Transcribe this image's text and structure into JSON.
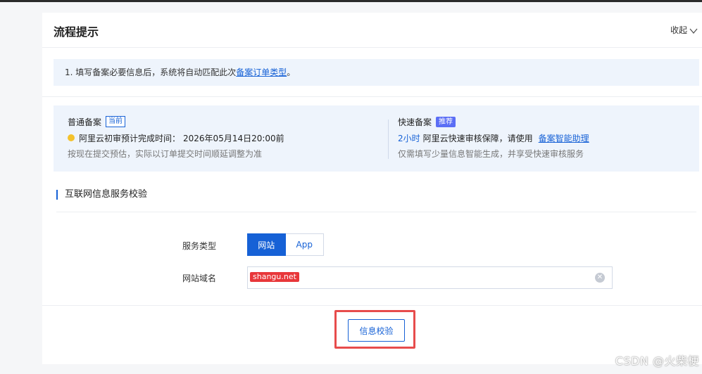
{
  "header": {
    "title": "流程提示",
    "collapse_label": "收起"
  },
  "tip": {
    "prefix": "1. 填写备案必要信息后，系统将自动匹配此次",
    "link": "备案订单类型",
    "suffix": "。"
  },
  "normal_filing": {
    "title": "普通备案",
    "tag": "当前",
    "eta_label": "阿里云初审预计完成时间：",
    "eta_value": "2026年05月14日20:00前",
    "note": "按现在提交预估，实际以订单提交时间顺延调整为准"
  },
  "fast_filing": {
    "title": "快速备案",
    "tag": "推荐",
    "time": "2小时",
    "desc": "阿里云快速审核保障，请使用",
    "link": "备案智能助理",
    "note": "仅需填写少量信息智能生成，并享受快速审核服务"
  },
  "section": {
    "title": "互联网信息服务校验"
  },
  "form": {
    "service_type_label": "服务类型",
    "service_types": [
      "网站",
      "App"
    ],
    "domain_label": "网站域名",
    "domain_value": "shangu.net"
  },
  "verify_button": "信息校验",
  "watermark": "CSDN @火柴梗"
}
